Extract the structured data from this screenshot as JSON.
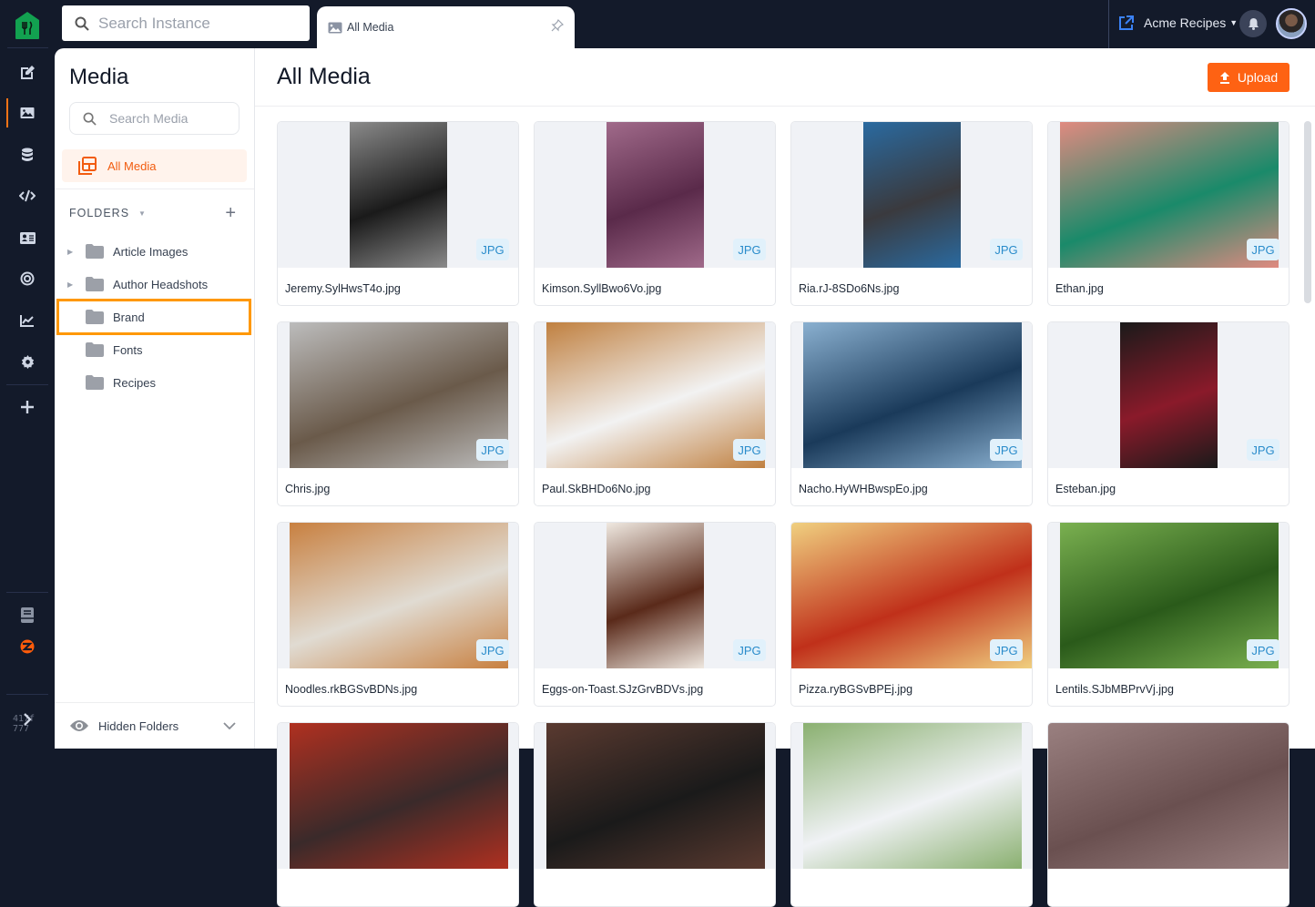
{
  "topbar": {
    "search_placeholder": "Search Instance",
    "tab_label": "All Media",
    "account_label": "Acme Recipes"
  },
  "rail": {
    "items": [
      "edit-icon",
      "media-icon",
      "database-icon",
      "code-icon",
      "contact-card-icon",
      "target-icon",
      "analytics-icon",
      "settings-icon",
      "add-icon"
    ],
    "active": "media-icon",
    "version": "417f\n777"
  },
  "panel": {
    "title": "Media",
    "search_placeholder": "Search Media",
    "all_media_label": "All Media",
    "folders_label": "FOLDERS",
    "folders": [
      {
        "name": "Article Images",
        "expandable": true
      },
      {
        "name": "Author Headshots",
        "expandable": true
      },
      {
        "name": "Brand",
        "expandable": false,
        "highlighted": true
      },
      {
        "name": "Fonts",
        "expandable": false
      },
      {
        "name": "Recipes",
        "expandable": false
      }
    ],
    "hidden_folders_label": "Hidden Folders"
  },
  "main": {
    "title": "All Media",
    "upload_label": "Upload",
    "files": [
      {
        "name": "Jeremy.SylHwsT4o.jpg",
        "type": "JPG",
        "colors": [
          "#1a1a1a",
          "#8a8a8a"
        ],
        "fit": "portrait"
      },
      {
        "name": "Kimson.SyllBwo6Vo.jpg",
        "type": "JPG",
        "colors": [
          "#5a2a4a",
          "#a06a8a"
        ],
        "fit": "portrait"
      },
      {
        "name": "Ria.rJ-8SDo6Ns.jpg",
        "type": "JPG",
        "colors": [
          "#3a3a3e",
          "#2a6aa0"
        ],
        "fit": "portrait"
      },
      {
        "name": "Ethan.jpg",
        "type": "JPG",
        "colors": [
          "#1a8a6a",
          "#e08a80"
        ],
        "fit": "wide"
      },
      {
        "name": "Chris.jpg",
        "type": "JPG",
        "colors": [
          "#6a5a4a",
          "#bcbcbc"
        ],
        "fit": "wide"
      },
      {
        "name": "Paul.SkBHDo6No.jpg",
        "type": "JPG",
        "colors": [
          "#f2f2f2",
          "#c08040"
        ],
        "fit": "wide"
      },
      {
        "name": "Nacho.HyWHBwspEo.jpg",
        "type": "JPG",
        "colors": [
          "#1a3a5a",
          "#8ab0d0"
        ],
        "fit": "wide"
      },
      {
        "name": "Esteban.jpg",
        "type": "JPG",
        "colors": [
          "#8a1a2a",
          "#1a1a1a"
        ],
        "fit": "portrait"
      },
      {
        "name": "Noodles.rkBGSvBDNs.jpg",
        "type": "JPG",
        "colors": [
          "#e0dbd2",
          "#c88040"
        ],
        "fit": "wide"
      },
      {
        "name": "Eggs-on-Toast.SJzGrvBDVs.jpg",
        "type": "JPG",
        "colors": [
          "#5a2a1a",
          "#efe8e0"
        ],
        "fit": "portrait"
      },
      {
        "name": "Pizza.ryBGSvBPEj.jpg",
        "type": "JPG",
        "colors": [
          "#c0301a",
          "#f0d080"
        ],
        "fit": "full"
      },
      {
        "name": "Lentils.SJbMBPrvVj.jpg",
        "type": "JPG",
        "colors": [
          "#2a5a1a",
          "#7ab050"
        ],
        "fit": "wide"
      },
      {
        "name": "",
        "type": "",
        "colors": [
          "#3a2a2a",
          "#b03020"
        ],
        "fit": "wide"
      },
      {
        "name": "",
        "type": "",
        "colors": [
          "#1a1a1a",
          "#5a3a30"
        ],
        "fit": "wide"
      },
      {
        "name": "",
        "type": "",
        "colors": [
          "#f0f2f5",
          "#8ab070"
        ],
        "fit": "wide"
      },
      {
        "name": "",
        "type": "",
        "colors": [
          "#6a5050",
          "#9a8080"
        ],
        "fit": "full"
      }
    ]
  }
}
